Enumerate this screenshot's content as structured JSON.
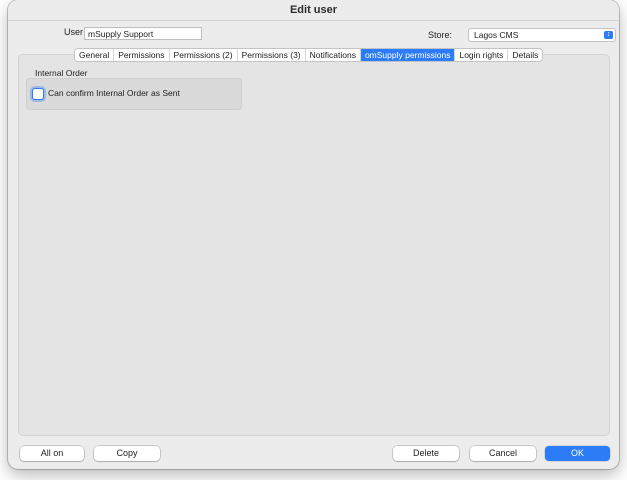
{
  "window": {
    "title": "Edit user"
  },
  "header": {
    "user_label": "User",
    "user_value": "mSupply Support",
    "store_label": "Store:",
    "store_value": "Lagos CMS"
  },
  "tabs": [
    {
      "label": "General"
    },
    {
      "label": "Permissions"
    },
    {
      "label": "Permissions (2)"
    },
    {
      "label": "Permissions (3)"
    },
    {
      "label": "Notifications"
    },
    {
      "label": "omSupply permissions",
      "active": true
    },
    {
      "label": "Login rights"
    },
    {
      "label": "Details"
    }
  ],
  "section": {
    "title": "Internal Order",
    "checkbox_label": "Can confirm Internal Order as Sent",
    "checked": false
  },
  "buttons": {
    "all_on": "All on",
    "copy": "Copy",
    "delete": "Delete",
    "cancel": "Cancel",
    "ok": "OK"
  },
  "colors": {
    "accent": "#2b7cf6"
  }
}
